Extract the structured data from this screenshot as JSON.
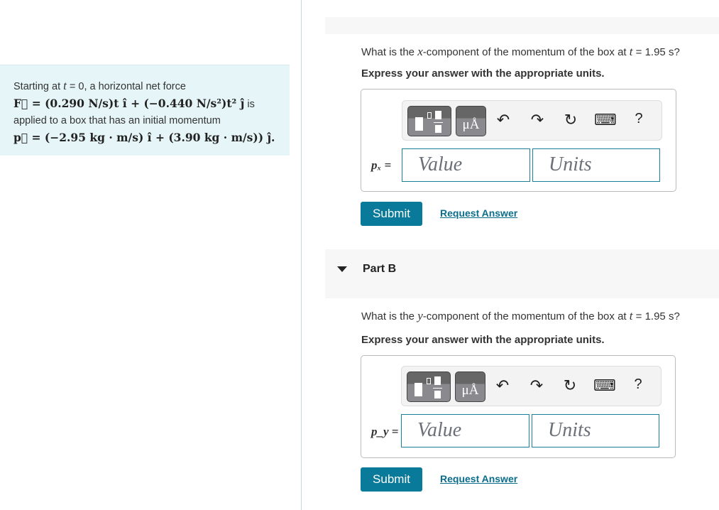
{
  "problem": {
    "line1": "Starting at ",
    "t": "t",
    "line1b": " = 0, a horizontal net force",
    "force": "F⃗ = (0.290 N/s)t î + (−0.440 N/s²)t² ĵ",
    "is": " is",
    "line3": "applied to a box that has an initial momentum",
    "momentum": "p⃗ = (−2.95 kg · m/s) î + (3.90 kg · m/s)) ĵ."
  },
  "partA": {
    "question_pre": "What is the ",
    "var": "x",
    "question_mid": "-component of the momentum of the box at ",
    "t": "t",
    "question_post": " = 1.95 s?",
    "instruction": "Express your answer with the appropriate units.",
    "label": "pₓ =",
    "value_placeholder": "Value",
    "units_placeholder": "Units",
    "submit": "Submit",
    "request": "Request Answer"
  },
  "partB": {
    "title": "Part B",
    "question_pre": "What is the ",
    "var": "y",
    "question_mid": "-component of the momentum of the box at ",
    "t": "t",
    "question_post": " = 1.95 s?",
    "instruction": "Express your answer with the appropriate units.",
    "label": "p_y =",
    "value_placeholder": "Value",
    "units_placeholder": "Units",
    "submit": "Submit",
    "request": "Request Answer"
  },
  "toolbar": {
    "units_btn": "μÅ",
    "help": "?",
    "undo": "↶",
    "redo": "↷",
    "reset": "↻",
    "keyboard": "⌨"
  },
  "colors": {
    "accent": "#0a7a9a",
    "problem_bg": "#e6f5f8",
    "input_border": "#1a7f99"
  }
}
